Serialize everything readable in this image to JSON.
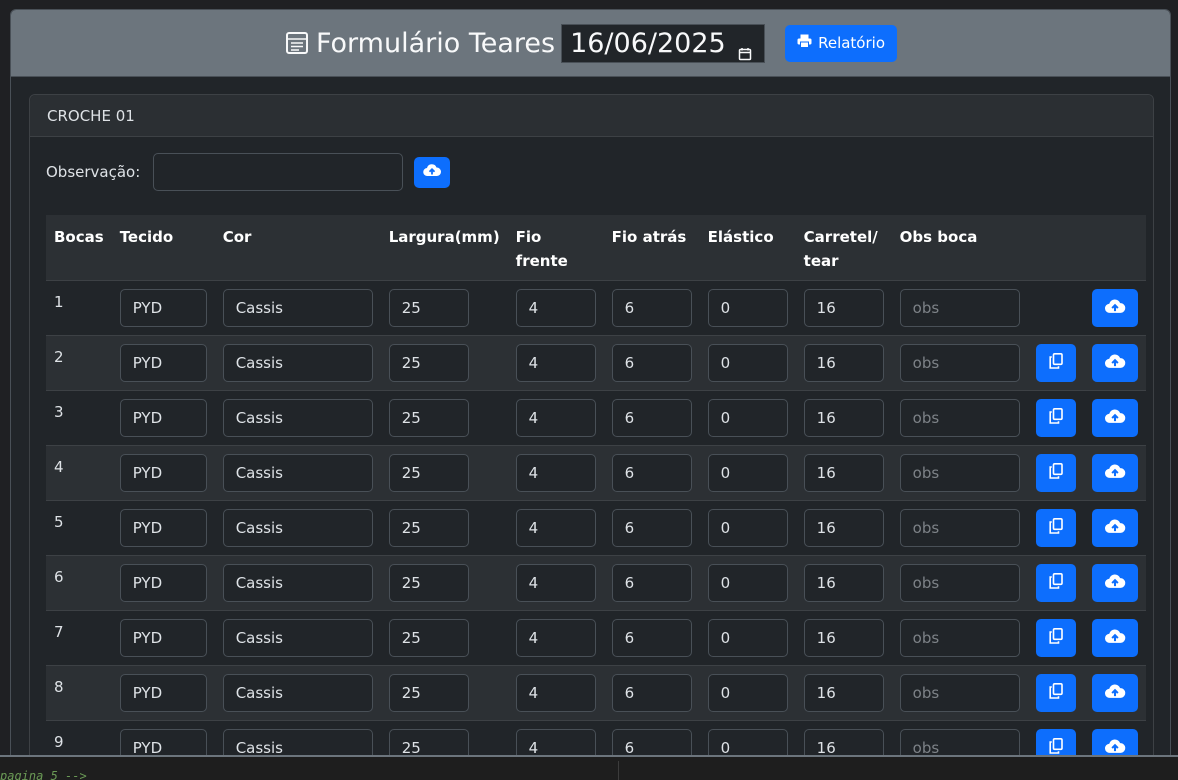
{
  "header": {
    "title": "Formulário Teares",
    "date": "16/06/2025",
    "report_label": "Relatório"
  },
  "card": {
    "title": "CROCHE 01",
    "obs_label": "Observação:",
    "obs_value": ""
  },
  "table": {
    "columns": [
      "Bocas",
      "Tecido",
      "Cor",
      "Largura(mm)",
      "Fio frente",
      "Fio atrás",
      "Elástico",
      "Carretel/ tear",
      "Obs boca"
    ],
    "obs_placeholder": "obs",
    "rows": [
      {
        "boca": "1",
        "tecido": "PYD",
        "cor": "Cassis",
        "largura": "25",
        "fio_frente": "4",
        "fio_atras": "6",
        "elastico": "0",
        "carretel": "16",
        "copy": false
      },
      {
        "boca": "2",
        "tecido": "PYD",
        "cor": "Cassis",
        "largura": "25",
        "fio_frente": "4",
        "fio_atras": "6",
        "elastico": "0",
        "carretel": "16",
        "copy": true
      },
      {
        "boca": "3",
        "tecido": "PYD",
        "cor": "Cassis",
        "largura": "25",
        "fio_frente": "4",
        "fio_atras": "6",
        "elastico": "0",
        "carretel": "16",
        "copy": true
      },
      {
        "boca": "4",
        "tecido": "PYD",
        "cor": "Cassis",
        "largura": "25",
        "fio_frente": "4",
        "fio_atras": "6",
        "elastico": "0",
        "carretel": "16",
        "copy": true
      },
      {
        "boca": "5",
        "tecido": "PYD",
        "cor": "Cassis",
        "largura": "25",
        "fio_frente": "4",
        "fio_atras": "6",
        "elastico": "0",
        "carretel": "16",
        "copy": true
      },
      {
        "boca": "6",
        "tecido": "PYD",
        "cor": "Cassis",
        "largura": "25",
        "fio_frente": "4",
        "fio_atras": "6",
        "elastico": "0",
        "carretel": "16",
        "copy": true
      },
      {
        "boca": "7",
        "tecido": "PYD",
        "cor": "Cassis",
        "largura": "25",
        "fio_frente": "4",
        "fio_atras": "6",
        "elastico": "0",
        "carretel": "16",
        "copy": true
      },
      {
        "boca": "8",
        "tecido": "PYD",
        "cor": "Cassis",
        "largura": "25",
        "fio_frente": "4",
        "fio_atras": "6",
        "elastico": "0",
        "carretel": "16",
        "copy": true
      },
      {
        "boca": "9",
        "tecido": "PYD",
        "cor": "Cassis",
        "largura": "25",
        "fio_frente": "4",
        "fio_atras": "6",
        "elastico": "0",
        "carretel": "16",
        "copy": true
      }
    ]
  },
  "status_bar": {
    "text": "pagina 5 -->"
  },
  "colors": {
    "primary": "#0d6efd",
    "header_bg": "#6c757d",
    "page_bg": "#212529"
  }
}
